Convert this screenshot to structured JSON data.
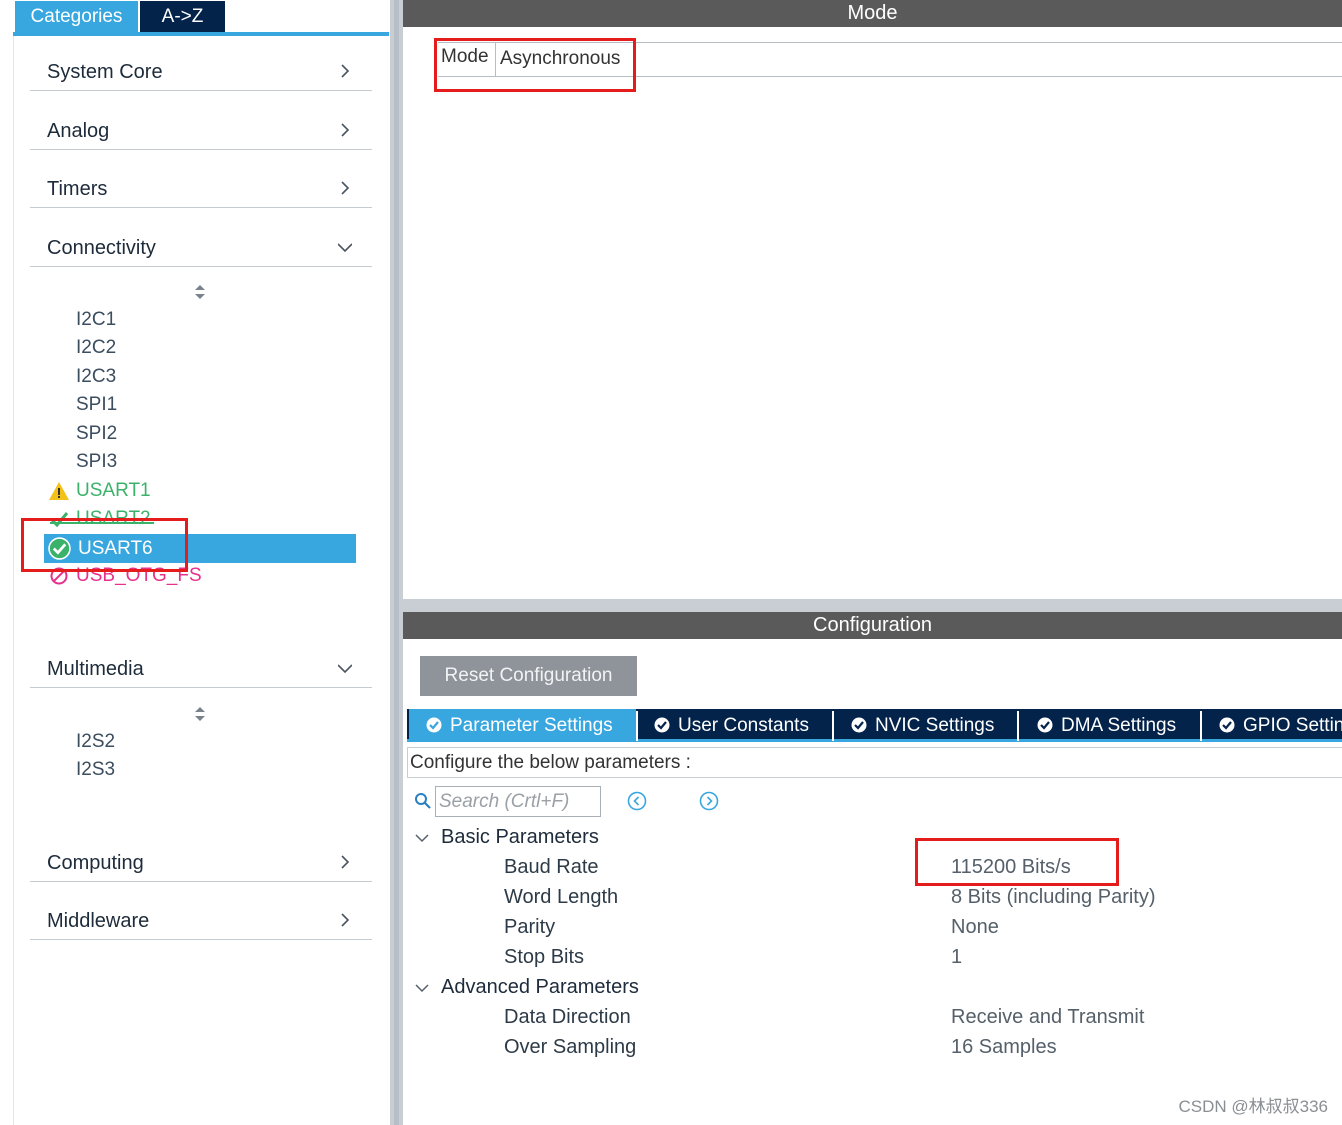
{
  "category_tabs": {
    "categories": "Categories",
    "az": "A->Z"
  },
  "categories": {
    "system_core": "System Core",
    "analog": "Analog",
    "timers": "Timers",
    "connectivity": "Connectivity",
    "multimedia": "Multimedia",
    "computing": "Computing",
    "middleware": "Middleware"
  },
  "connectivity_items": [
    "I2C1",
    "I2C2",
    "I2C3",
    "SPI1",
    "SPI2",
    "SPI3",
    "USART1",
    "USART2",
    "USART6",
    "USB_OTG_FS"
  ],
  "multimedia_items": [
    "I2S2",
    "I2S3"
  ],
  "mode_panel": {
    "header": "Mode",
    "mode_label": "Mode",
    "mode_value": "Asynchronous"
  },
  "configuration": {
    "header": "Configuration",
    "reset_button": "Reset Configuration",
    "tabs": [
      "Parameter Settings",
      "User Constants",
      "NVIC Settings",
      "DMA Settings",
      "GPIO Settings"
    ],
    "configure_label": "Configure the below parameters :",
    "search_placeholder": "Search (Crtl+F)",
    "groups": {
      "basic": {
        "label": "Basic Parameters",
        "params": [
          {
            "name": "Baud Rate",
            "value": "115200 Bits/s"
          },
          {
            "name": "Word Length",
            "value": "8 Bits (including Parity)"
          },
          {
            "name": "Parity",
            "value": "None"
          },
          {
            "name": "Stop Bits",
            "value": "1"
          }
        ]
      },
      "advanced": {
        "label": "Advanced Parameters",
        "params": [
          {
            "name": "Data Direction",
            "value": "Receive and Transmit"
          },
          {
            "name": "Over Sampling",
            "value": "16 Samples"
          }
        ]
      }
    }
  },
  "watermark": "CSDN @林叔叔336",
  "colors": {
    "accent": "#39a7df",
    "dark_navy": "#03234b",
    "header_gray": "#5a5a5a",
    "ok_green": "#3bb26a",
    "warning_yellow": "#f2c21b",
    "error_pink": "#e72f8c",
    "highlight_red": "#e51c1c"
  },
  "icons": {
    "chevron_right": "chevron-right-icon",
    "chevron_down": "chevron-down-icon",
    "warning": "warning-icon",
    "check": "check-icon",
    "blocked": "blocked-icon",
    "search": "search-icon",
    "prev": "prev-match-icon",
    "next": "next-match-icon"
  }
}
